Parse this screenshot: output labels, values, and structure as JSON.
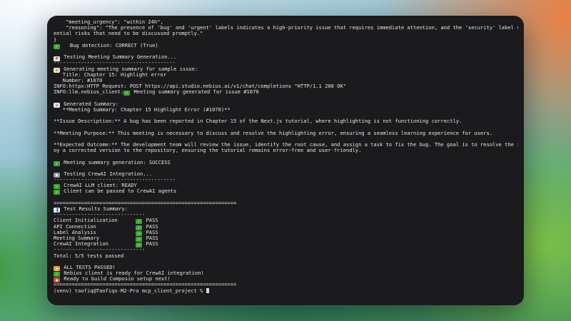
{
  "colors": {
    "terminal_bg": "#1b1b1d",
    "terminal_text": "#e4e4e4",
    "check_green": "#3aa832"
  },
  "terminal": {
    "lines": [
      {
        "text": "    \"meeting_urgency\": \"within 24h\","
      },
      {
        "text": "    \"reasoning\": \"The presence of 'bug' and 'urgent' labels indicates a high-priority issue that requires immediate attention, and the 'security' label suggests pot",
        "wrap": false
      },
      {
        "text": "ential risks that need to be discussed promptly.\""
      },
      {
        "text": "}"
      },
      {
        "text": "  Bug detection: CORRECT (True)",
        "icon": "check-icon"
      },
      {
        "text": ""
      },
      {
        "text": "Testing Meeting Summary Generation...",
        "icon": "calendar-icon"
      },
      {
        "text": "----------------------------------------"
      },
      {
        "text": "Generating meeting summary for sample issue:",
        "icon": "memo-icon"
      },
      {
        "text": "   Title: Chapter 15: Highlight error"
      },
      {
        "text": "   Number: #1070"
      },
      {
        "text": "INFO:httpx:HTTP Request: POST https://api.studio.nebius.ai/v1/chat/completions \"HTTP/1.1 200 OK\""
      },
      {
        "text": "INFO:llm.nebius_client: Meeting summary generated for issue #1070",
        "inline_icon": "check-icon",
        "inline_after": "INFO:llm.nebius_client:"
      },
      {
        "text": ""
      },
      {
        "text": "Generated Summary:",
        "icon": "document-icon"
      },
      {
        "text": "   **Meeting Summary: Chapter 15 Highlight Error (#1070)**"
      },
      {
        "text": ""
      },
      {
        "text": "**Issue Description:** A bug has been reported in Chapter 15 of the Next.js tutorial, where highlighting is not functioning correctly."
      },
      {
        "text": ""
      },
      {
        "text": "**Meeting Purpose:** This meeting is necessary to discuss and resolve the highlighting error, ensuring a seamless learning experience for users."
      },
      {
        "text": ""
      },
      {
        "text": "**Expected Outcome:** The development team will review the issue, identify the root cause, and assign a task to fix the bug. The goal is to resolve the issue and depl"
      },
      {
        "text": "oy a corrected version to the repository, ensuring the tutorial remains error-free and user-friendly."
      },
      {
        "text": ""
      },
      {
        "text": "Meeting summary generation: SUCCESS",
        "icon": "check-icon"
      },
      {
        "text": ""
      },
      {
        "text": "Testing CrewAI Integration...",
        "icon": "robot-icon"
      },
      {
        "text": "----------------------------------------"
      },
      {
        "text": "CrewAI LLM client: READY",
        "icon": "check-icon"
      },
      {
        "text": "Client can be passed to CrewAI agents",
        "icon": "check-icon"
      },
      {
        "text": ""
      },
      {
        "text": "============================================================"
      },
      {
        "text": "Test Results Summary:",
        "icon": "chart-icon"
      },
      {
        "text": "------------------------------"
      },
      {
        "text": "Client Initialization      ",
        "status": "PASS"
      },
      {
        "text": "API Connection             ",
        "status": "PASS"
      },
      {
        "text": "Label Analysis             ",
        "status": "PASS"
      },
      {
        "text": "Meeting Summary            ",
        "status": "PASS"
      },
      {
        "text": "CrewAI Integration         ",
        "status": "PASS"
      },
      {
        "text": "------------------------------"
      },
      {
        "text": "Total: 5/5 tests passed"
      },
      {
        "text": ""
      },
      {
        "text": "ALL TESTS PASSED!",
        "icon": "party-icon"
      },
      {
        "text": "Nebius client is ready for CrewAI integration!",
        "icon": "check-icon"
      },
      {
        "text": "Ready to build Composio setup next!",
        "icon": "rocket-icon"
      },
      {
        "text": "============================================================"
      }
    ],
    "prompt": "(venv) taofiq@Taofiqs-M2-Pro mcp_client_project % "
  }
}
